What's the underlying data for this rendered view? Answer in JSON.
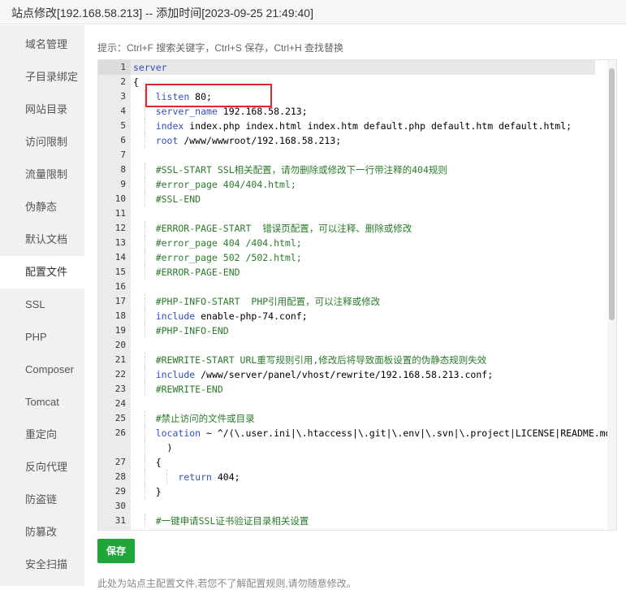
{
  "window": {
    "title": "站点修改[192.168.58.213] -- 添加时间[2023-09-25 21:49:40]"
  },
  "sidebar": {
    "items": [
      {
        "label": "域名管理"
      },
      {
        "label": "子目录绑定"
      },
      {
        "label": "网站目录"
      },
      {
        "label": "访问限制"
      },
      {
        "label": "流量限制"
      },
      {
        "label": "伪静态"
      },
      {
        "label": "默认文档"
      },
      {
        "label": "配置文件",
        "active": true
      },
      {
        "label": "SSL"
      },
      {
        "label": "PHP"
      },
      {
        "label": "Composer"
      },
      {
        "label": "Tomcat"
      },
      {
        "label": "重定向"
      },
      {
        "label": "反向代理"
      },
      {
        "label": "防盗链"
      },
      {
        "label": "防篡改"
      },
      {
        "label": "安全扫描"
      }
    ]
  },
  "main": {
    "tip": "提示：Ctrl+F 搜索关键字，Ctrl+S 保存，Ctrl+H 查找替换",
    "save_label": "保存",
    "note": "此处为站点主配置文件,若您不了解配置规则,请勿随意修改。"
  },
  "editor": {
    "lines": [
      {
        "n": "1",
        "text": "server"
      },
      {
        "n": "2",
        "text": "{"
      },
      {
        "n": "3",
        "text": "    listen 80;"
      },
      {
        "n": "4",
        "text": "    server_name 192.168.58.213;"
      },
      {
        "n": "5",
        "text": "    index index.php index.html index.htm default.php default.htm default.html;"
      },
      {
        "n": "6",
        "text": "    root /www/wwwroot/192.168.58.213;"
      },
      {
        "n": "7",
        "text": ""
      },
      {
        "n": "8",
        "text": "    #SSL-START SSL相关配置，请勿删除或修改下一行带注释的404规则"
      },
      {
        "n": "9",
        "text": "    #error_page 404/404.html;"
      },
      {
        "n": "10",
        "text": "    #SSL-END"
      },
      {
        "n": "11",
        "text": ""
      },
      {
        "n": "12",
        "text": "    #ERROR-PAGE-START  错误页配置，可以注释、删除或修改"
      },
      {
        "n": "13",
        "text": "    #error_page 404 /404.html;"
      },
      {
        "n": "14",
        "text": "    #error_page 502 /502.html;"
      },
      {
        "n": "15",
        "text": "    #ERROR-PAGE-END"
      },
      {
        "n": "16",
        "text": ""
      },
      {
        "n": "17",
        "text": "    #PHP-INFO-START  PHP引用配置，可以注释或修改"
      },
      {
        "n": "18",
        "text": "    include enable-php-74.conf;"
      },
      {
        "n": "19",
        "text": "    #PHP-INFO-END"
      },
      {
        "n": "20",
        "text": ""
      },
      {
        "n": "21",
        "text": "    #REWRITE-START URL重写规则引用,修改后将导致面板设置的伪静态规则失效"
      },
      {
        "n": "22",
        "text": "    include /www/server/panel/vhost/rewrite/192.168.58.213.conf;"
      },
      {
        "n": "23",
        "text": "    #REWRITE-END"
      },
      {
        "n": "24",
        "text": ""
      },
      {
        "n": "25",
        "text": "    #禁止访问的文件或目录"
      },
      {
        "n": "26",
        "text": "    location ~ ^/(\\.user.ini|\\.htaccess|\\.git|\\.env|\\.svn|\\.project|LICENSE|README.md"
      },
      {
        "n": "",
        "text": "      )"
      },
      {
        "n": "27",
        "text": "    {"
      },
      {
        "n": "28",
        "text": "        return 404;"
      },
      {
        "n": "29",
        "text": "    }"
      },
      {
        "n": "30",
        "text": ""
      },
      {
        "n": "31",
        "text": "    #一键申请SSL证书验证目录相关设置"
      }
    ]
  },
  "colors": {
    "save_button": "#20a53a",
    "highlight_box": "#e3262b",
    "keyword": "#2f4fbf",
    "comment": "#2b7a2b"
  }
}
